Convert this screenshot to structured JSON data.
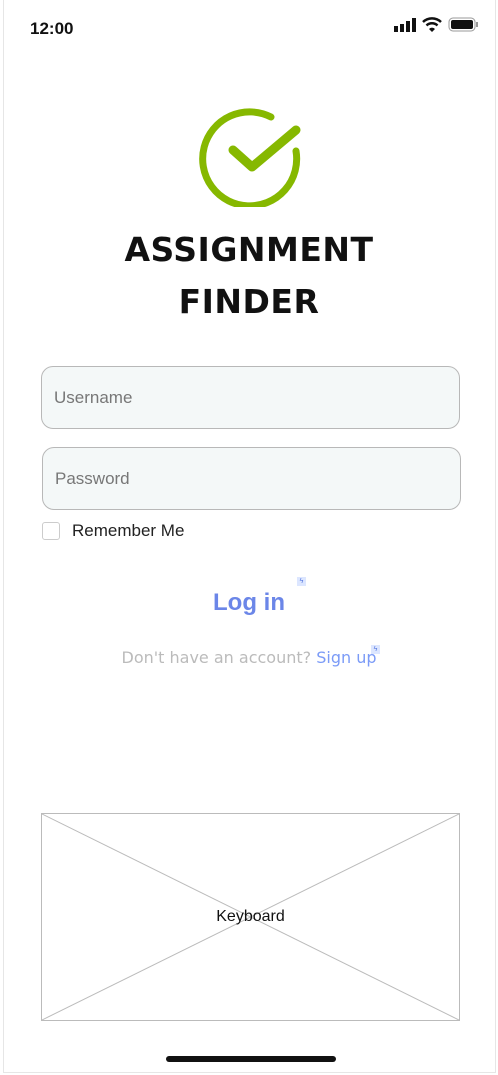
{
  "status_bar": {
    "time": "12:00",
    "icons": [
      "signal-icon",
      "wifi-icon",
      "battery-icon"
    ]
  },
  "app": {
    "title_line1": "ASSIGNMENT",
    "title_line2": "FINDER",
    "logo": "check-circle-icon",
    "brand_color": "#86b800"
  },
  "form": {
    "username_placeholder": "Username",
    "password_placeholder": "Password",
    "remember_label": "Remember Me",
    "login_label": "Log in",
    "signup_prompt": "Don't have an account?",
    "signup_link": "Sign up"
  },
  "keyboard": {
    "label": "Keyboard"
  },
  "colors": {
    "accent": "#6b86e8",
    "link": "#7b9bf7"
  }
}
